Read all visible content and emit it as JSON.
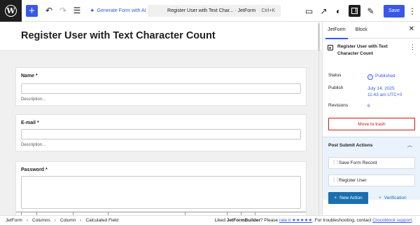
{
  "toolbar": {
    "ai_label": "Generate Form with AI",
    "command_title": "Register User with Text Char... · JetForm",
    "shortcut": "Ctrl+K",
    "save_label": "Save",
    "icons": [
      "wordpress-logo",
      "plus-icon",
      "undo-icon",
      "redo-icon",
      "list-view-icon",
      "sparkle-icon",
      "desktop-preview-icon",
      "external-link-icon",
      "dark-mode-icon",
      "sidebar-toggle-icon",
      "brush-icon",
      "more-vertical-icon"
    ]
  },
  "editor": {
    "title": "Register User with Text Character Count",
    "fields": [
      {
        "label": "Name *",
        "description": "Description..."
      },
      {
        "label": "E-mail *",
        "description": "Description..."
      },
      {
        "label": "Password *"
      }
    ]
  },
  "sidebar": {
    "tabs": [
      "JetForm",
      "Block"
    ],
    "doc_title": "Register User with Text Character Count",
    "status_label": "Status",
    "status_value": "Published",
    "publish_label": "Publish",
    "publish_date": "July 14, 2025",
    "publish_time": "11:43 am UTC+0",
    "revisions_label": "Revisions",
    "revisions_value": "6",
    "trash_label": "Move to trash",
    "psa_title": "Post Submit Actions",
    "actions": [
      "Save Form Record",
      "Register User"
    ],
    "new_action_label": "New Action",
    "verification_label": "Verification"
  },
  "footer": {
    "breadcrumbs": [
      "JetForm",
      "Columns",
      "Column",
      "Calculated Field"
    ],
    "note_prefix": "Liked ",
    "note_brand": "JetFormBuilder",
    "note_mid": "? Please ",
    "note_rate": "rate it ★★★★★",
    "note_suffix": ". For troubleshooting, contact ",
    "note_support": "Crocoblock support",
    "note_end": "."
  },
  "colors": {
    "accent": "#3858e9",
    "danger": "#cc1818",
    "panel": "#eaf2fb",
    "action_button": "#1a6fb0"
  }
}
